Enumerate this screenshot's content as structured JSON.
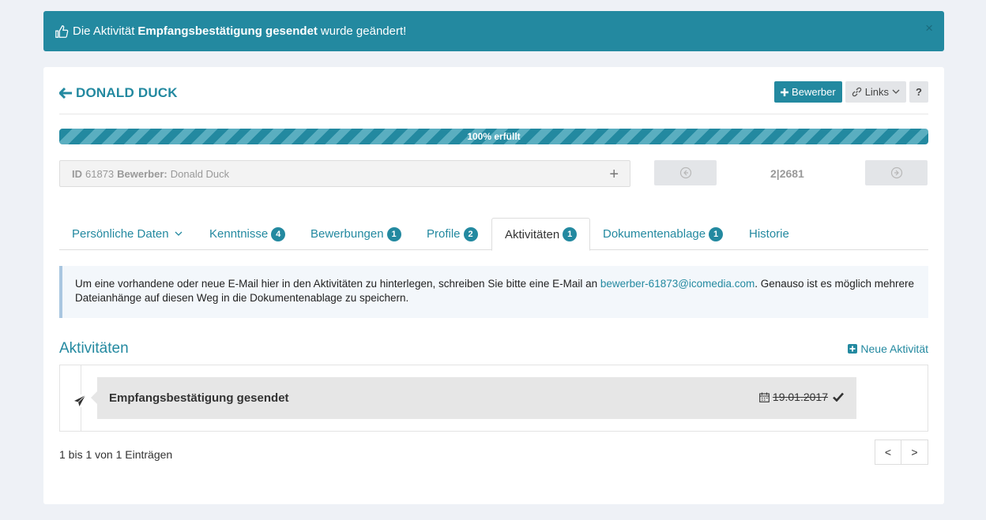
{
  "alert": {
    "prefix": "Die Aktivität",
    "activity": "Empfangsbestätigung gesendet",
    "suffix": "wurde geändert!",
    "close": "×"
  },
  "header": {
    "name": "DONALD DUCK",
    "bewerber_btn": "Bewerber",
    "links_btn": "Links",
    "help_btn": "?"
  },
  "progress": {
    "label": "100% erfüllt",
    "value": 100
  },
  "record": {
    "id_label": "ID",
    "id_value": "61873",
    "bewerber_label": "Bewerber:",
    "bewerber_value": "Donald Duck",
    "plus": "+",
    "counter": "2|2681"
  },
  "tabs": [
    {
      "label": "Persönliche Daten",
      "badge": null
    },
    {
      "label": "Kenntnisse",
      "badge": "4"
    },
    {
      "label": "Bewerbungen",
      "badge": "1"
    },
    {
      "label": "Profile",
      "badge": "2"
    },
    {
      "label": "Aktivitäten",
      "badge": "1"
    },
    {
      "label": "Dokumentenablage",
      "badge": "1"
    },
    {
      "label": "Historie",
      "badge": null
    }
  ],
  "info": {
    "text1": "Um eine vorhandene oder neue E-Mail hier in den Aktivitäten zu hinterlegen, schreiben Sie bitte eine E-Mail an",
    "email": "bewerber-61873@icomedia.com",
    "text2": ". Genauso ist es möglich mehrere Dateianhänge auf diesen Weg in die Dokumentenablage zu speichern."
  },
  "activities": {
    "heading": "Aktivitäten",
    "new_label": "Neue Aktivität",
    "entries": [
      {
        "title": "Empfangsbestätigung gesendet",
        "date": "19.01.2017"
      }
    ],
    "count_text": "1 bis 1 von 1 Einträgen",
    "prev": "<",
    "next": ">"
  }
}
